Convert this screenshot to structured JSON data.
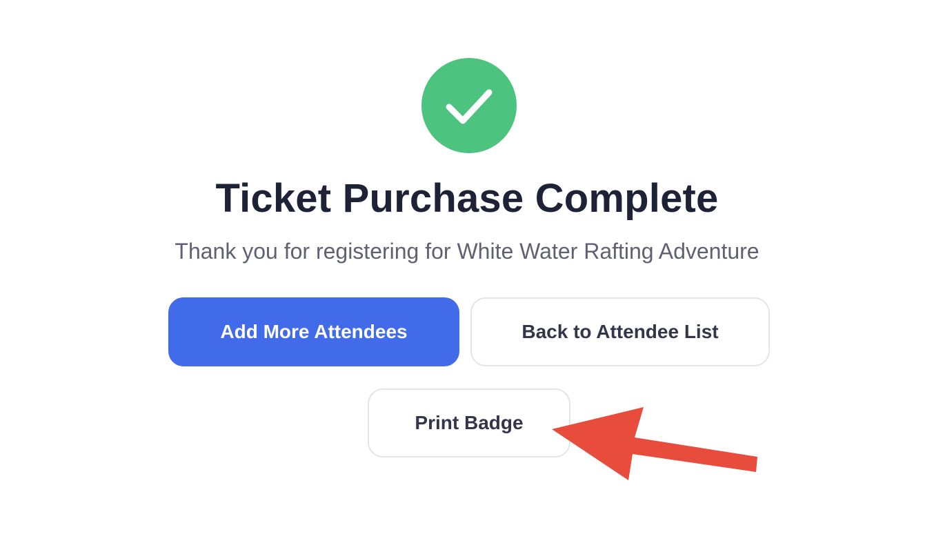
{
  "confirmation": {
    "icon": "checkmark-icon",
    "title": "Ticket Purchase Complete",
    "subtitle": "Thank you for registering for White Water Rafting Adventure"
  },
  "actions": {
    "add_more_label": "Add More Attendees",
    "back_label": "Back to Attendee List",
    "print_label": "Print Badge"
  },
  "annotation": {
    "icon": "arrow-pointer-icon",
    "target": "Print Badge"
  },
  "colors": {
    "success": "#4cc47f",
    "primary": "#416be8",
    "arrow": "#e84c3d",
    "title": "#1d2236",
    "subtitle": "#5f6173"
  }
}
